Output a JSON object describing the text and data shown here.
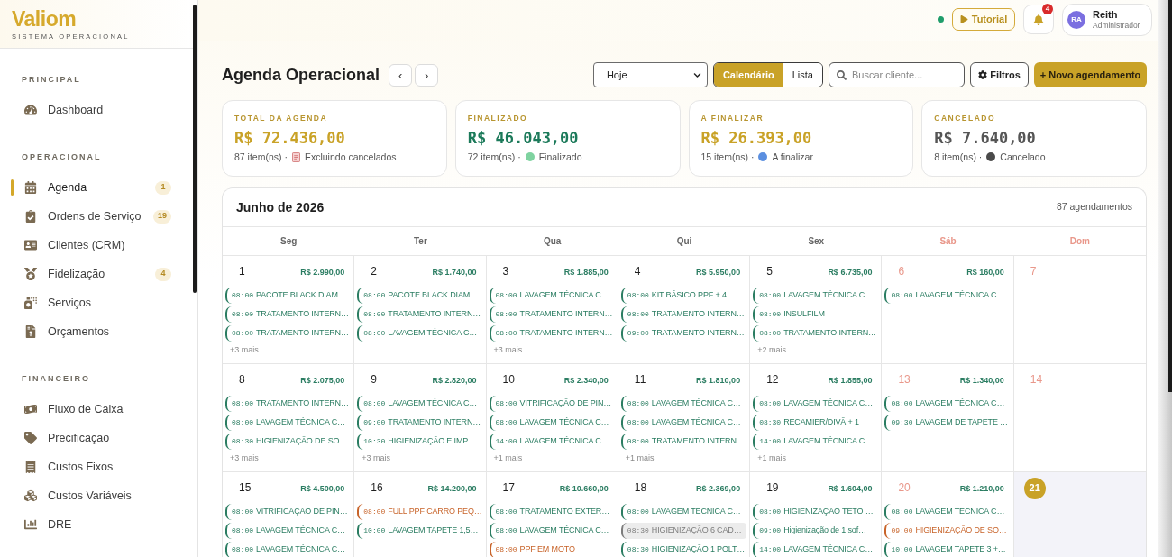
{
  "sidebar": {
    "logo": {
      "name": "Valiom",
      "tagline": "SISTEMA OPERACIONAL"
    },
    "sections": [
      {
        "title": "PRINCIPAL",
        "items": [
          {
            "label": "Dashboard",
            "selected": false
          }
        ]
      },
      {
        "title": "OPERACIONAL",
        "items": [
          {
            "label": "Agenda",
            "badge": "1",
            "selected": true
          },
          {
            "label": "Ordens de Serviço",
            "badge": "19",
            "selected": false
          },
          {
            "label": "Clientes (CRM)",
            "selected": false
          },
          {
            "label": "Fidelização",
            "badge": "4",
            "selected": false
          },
          {
            "label": "Serviços",
            "selected": false
          },
          {
            "label": "Orçamentos",
            "selected": false
          }
        ]
      },
      {
        "title": "FINANCEIRO",
        "items": [
          {
            "label": "Fluxo de Caixa",
            "selected": false
          },
          {
            "label": "Precificação",
            "selected": false
          },
          {
            "label": "Custos Fixos",
            "selected": false
          },
          {
            "label": "Custos Variáveis",
            "selected": false
          },
          {
            "label": "DRE",
            "selected": false
          }
        ]
      }
    ]
  },
  "header": {
    "online": true,
    "tutorial": "Tutorial",
    "notifications": "4",
    "user": {
      "initials": "RA",
      "name": "Reith",
      "role": "Administrador"
    }
  },
  "toolbar": {
    "title": "Agenda Operacional",
    "prev": "‹",
    "next": "›",
    "period": "Hoje",
    "views": [
      {
        "label": "Calendário",
        "selected": true
      },
      {
        "label": "Lista",
        "selected": false
      }
    ],
    "search": {
      "placeholder": "Buscar cliente..."
    },
    "filters": "Filtros",
    "new_button": "+ Novo agendamento"
  },
  "summary_cards": [
    {
      "label": "TOTAL DA AGENDA",
      "amount": "R$ 72.436,00",
      "color": "#c9a227",
      "count": "87 item(ns) ·",
      "icon": {
        "kind": "receipt"
      },
      "note": "Excluindo cancelados"
    },
    {
      "label": "FINALIZADO",
      "amount": "R$ 46.043,00",
      "color": "#1c7a5a",
      "count": "72 item(ns) ·",
      "icon": {
        "kind": "dot",
        "color": "#7fd3a0"
      },
      "note": "Finalizado"
    },
    {
      "label": "A FINALIZAR",
      "amount": "R$ 26.393,00",
      "color": "#c9a227",
      "count": "15 item(ns) ·",
      "icon": {
        "kind": "dot",
        "color": "#5b8fe0"
      },
      "note": "A finalizar"
    },
    {
      "label": "CANCELADO",
      "amount": "R$ 7.640,00",
      "color": "#555555",
      "count": "8 item(ns) ·",
      "icon": {
        "kind": "dot",
        "color": "#4a4a4a"
      },
      "note": "Cancelado"
    }
  ],
  "calendar": {
    "month": "Junho de 2026",
    "count": "87 agendamentos",
    "weekdays": [
      {
        "label": "Seg",
        "weekend": false
      },
      {
        "label": "Ter",
        "weekend": false
      },
      {
        "label": "Qua",
        "weekend": false
      },
      {
        "label": "Qui",
        "weekend": false
      },
      {
        "label": "Sex",
        "weekend": false
      },
      {
        "label": "Sáb",
        "weekend": true
      },
      {
        "label": "Dom",
        "weekend": true
      }
    ],
    "weeks": [
      {
        "days": [
          {
            "day": "1",
            "total": "R$ 2.990,00",
            "today": false,
            "events": [
              {
                "time": "08:00",
                "title": "PACOTE BLACK DIAM…",
                "color": "#2b7d62",
                "highlighted": false
              },
              {
                "time": "08:00",
                "title": "TRATAMENTO INTERN…",
                "color": "#2b7d62",
                "highlighted": false
              },
              {
                "time": "08:00",
                "title": "TRATAMENTO INTERN…",
                "color": "#2b7d62",
                "highlighted": false
              }
            ],
            "more": "+3 mais"
          },
          {
            "day": "2",
            "total": "R$ 1.740,00",
            "today": false,
            "events": [
              {
                "time": "08:00",
                "title": "PACOTE BLACK DIAM…",
                "color": "#2b7d62",
                "highlighted": false
              },
              {
                "time": "08:00",
                "title": "TRATAMENTO INTERN…",
                "color": "#2b7d62",
                "highlighted": false
              },
              {
                "time": "08:00",
                "title": "LAVAGEM TÉCNICA C…",
                "color": "#2b7d62",
                "highlighted": false
              }
            ]
          },
          {
            "day": "3",
            "total": "R$ 1.885,00",
            "today": false,
            "events": [
              {
                "time": "08:00",
                "title": "LAVAGEM TÉCNICA C…",
                "color": "#2b7d62",
                "highlighted": false
              },
              {
                "time": "08:00",
                "title": "TRATAMENTO INTERN…",
                "color": "#2b7d62",
                "highlighted": false
              },
              {
                "time": "08:00",
                "title": "TRATAMENTO INTERN…",
                "color": "#2b7d62",
                "highlighted": false
              }
            ],
            "more": "+3 mais"
          },
          {
            "day": "4",
            "total": "R$ 5.950,00",
            "today": false,
            "events": [
              {
                "time": "08:00",
                "title": "KIT BÁSICO PPF + 4",
                "color": "#2b7d62",
                "highlighted": false
              },
              {
                "time": "08:00",
                "title": "TRATAMENTO INTERN…",
                "color": "#2b7d62",
                "highlighted": false
              },
              {
                "time": "09:00",
                "title": "TRATAMENTO INTERN…",
                "color": "#2b7d62",
                "highlighted": false
              }
            ]
          },
          {
            "day": "5",
            "total": "R$ 6.735,00",
            "today": false,
            "events": [
              {
                "time": "08:00",
                "title": "LAVAGEM TÉCNICA C…",
                "color": "#2b7d62",
                "highlighted": false
              },
              {
                "time": "08:00",
                "title": "INSULFILM",
                "color": "#2b7d62",
                "highlighted": false
              },
              {
                "time": "08:00",
                "title": "TRATAMENTO INTERN…",
                "color": "#2b7d62",
                "highlighted": false
              }
            ],
            "more": "+2 mais"
          },
          {
            "day": "6",
            "total": "R$ 160,00",
            "today": false,
            "events": [
              {
                "time": "08:00",
                "title": "LAVAGEM TÉCNICA C…",
                "color": "#2b7d62",
                "highlighted": false
              }
            ]
          },
          {
            "day": "7",
            "today": false
          }
        ]
      },
      {
        "days": [
          {
            "day": "8",
            "total": "R$ 2.075,00",
            "today": false,
            "events": [
              {
                "time": "08:00",
                "title": "TRATAMENTO INTERN…",
                "color": "#2b7d62",
                "highlighted": false
              },
              {
                "time": "08:00",
                "title": "LAVAGEM TÉCNICA C…",
                "color": "#2b7d62",
                "highlighted": false
              },
              {
                "time": "08:30",
                "title": "HIGIENIZAÇÃO DE SO…",
                "color": "#2b7d62",
                "highlighted": false
              }
            ],
            "more": "+3 mais"
          },
          {
            "day": "9",
            "total": "R$ 2.820,00",
            "today": false,
            "events": [
              {
                "time": "08:00",
                "title": "LAVAGEM TÉCNICA C…",
                "color": "#2b7d62",
                "highlighted": false
              },
              {
                "time": "09:00",
                "title": "TRATAMENTO INTERN…",
                "color": "#2b7d62",
                "highlighted": false
              },
              {
                "time": "10:30",
                "title": "HIGIENIZAÇÃO E IMP…",
                "color": "#2b7d62",
                "highlighted": false
              }
            ],
            "more": "+3 mais"
          },
          {
            "day": "10",
            "total": "R$ 2.340,00",
            "today": false,
            "events": [
              {
                "time": "08:00",
                "title": "VITRIFICAÇÃO DE PIN…",
                "color": "#2b7d62",
                "highlighted": false
              },
              {
                "time": "08:00",
                "title": "LAVAGEM TÉCNICA C…",
                "color": "#2b7d62",
                "highlighted": false
              },
              {
                "time": "14:00",
                "title": "LAVAGEM TÉCNICA C…",
                "color": "#2b7d62",
                "highlighted": false
              }
            ],
            "more": "+1 mais"
          },
          {
            "day": "11",
            "total": "R$ 1.810,00",
            "today": false,
            "events": [
              {
                "time": "08:00",
                "title": "LAVAGEM TÉCNICA C…",
                "color": "#2b7d62",
                "highlighted": false
              },
              {
                "time": "08:00",
                "title": "LAVAGEM TÉCNICA C…",
                "color": "#2b7d62",
                "highlighted": false
              },
              {
                "time": "08:00",
                "title": "TRATAMENTO INTERN…",
                "color": "#2b7d62",
                "highlighted": false
              }
            ],
            "more": "+1 mais"
          },
          {
            "day": "12",
            "total": "R$ 1.855,00",
            "today": false,
            "events": [
              {
                "time": "08:00",
                "title": "LAVAGEM TÉCNICA C…",
                "color": "#2b7d62",
                "highlighted": false
              },
              {
                "time": "08:30",
                "title": "RECAMIER/DIVÃ + 1",
                "color": "#2b7d62",
                "highlighted": false
              },
              {
                "time": "14:00",
                "title": "LAVAGEM TÉCNICA C…",
                "color": "#2b7d62",
                "highlighted": false
              }
            ],
            "more": "+1 mais"
          },
          {
            "day": "13",
            "total": "R$ 1.340,00",
            "today": false,
            "events": [
              {
                "time": "08:00",
                "title": "LAVAGEM TÉCNICA C…",
                "color": "#2b7d62",
                "highlighted": false
              },
              {
                "time": "09:30",
                "title": "LAVAGEM DE TAPETE …",
                "color": "#2b7d62",
                "highlighted": false
              }
            ]
          },
          {
            "day": "14",
            "today": false
          }
        ]
      },
      {
        "days": [
          {
            "day": "15",
            "total": "R$ 4.500,00",
            "today": false,
            "events": [
              {
                "time": "08:00",
                "title": "VITRIFICAÇÃO DE PIN…",
                "color": "#2b7d62",
                "highlighted": false
              },
              {
                "time": "08:00",
                "title": "LAVAGEM TÉCNICA C…",
                "color": "#2b7d62",
                "highlighted": false
              },
              {
                "time": "08:00",
                "title": "LAVAGEM TÉCNICA C…",
                "color": "#2b7d62",
                "highlighted": false
              }
            ]
          },
          {
            "day": "16",
            "total": "R$ 14.200,00",
            "today": false,
            "events": [
              {
                "time": "08:00",
                "title": "FULL PPF CARRO PEQ…",
                "color": "#c8642a",
                "highlighted": false
              },
              {
                "time": "10:00",
                "title": "LAVAGEM TAPETE 1,5…",
                "color": "#2b7d62",
                "highlighted": false
              }
            ]
          },
          {
            "day": "17",
            "total": "R$ 10.660,00",
            "today": false,
            "events": [
              {
                "time": "08:00",
                "title": "TRATAMENTO EXTER…",
                "color": "#2b7d62",
                "highlighted": false
              },
              {
                "time": "08:00",
                "title": "LAVAGEM TÉCNICA C…",
                "color": "#2b7d62",
                "highlighted": false
              },
              {
                "time": "08:00",
                "title": "PPF EM MOTO",
                "color": "#c8642a",
                "highlighted": false
              }
            ]
          },
          {
            "day": "18",
            "total": "R$ 2.369,00",
            "today": false,
            "events": [
              {
                "time": "08:00",
                "title": "LAVAGEM TÉCNICA C…",
                "color": "#2b7d62",
                "highlighted": false
              },
              {
                "time": "08:30",
                "title": "HIGIENIZAÇÃO 6 CAD…",
                "color": "#7d7d7d",
                "highlighted": true
              },
              {
                "time": "08:30",
                "title": "HIGIENIZAÇÃO 1 POLT…",
                "color": "#2b7d62",
                "highlighted": false
              }
            ]
          },
          {
            "day": "19",
            "total": "R$ 1.604,00",
            "today": false,
            "events": [
              {
                "time": "08:00",
                "title": "HIGIENIZAÇÃO TETO …",
                "color": "#2b7d62",
                "highlighted": false
              },
              {
                "time": "09:00",
                "title": "Higienização de 1 sof…",
                "color": "#2b7d62",
                "highlighted": false
              },
              {
                "time": "14:00",
                "title": "LAVAGEM TÉCNICA C…",
                "color": "#2b7d62",
                "highlighted": false
              }
            ]
          },
          {
            "day": "20",
            "total": "R$ 1.210,00",
            "today": false,
            "events": [
              {
                "time": "08:00",
                "title": "LAVAGEM TÉCNICA C…",
                "color": "#2b7d62",
                "highlighted": false
              },
              {
                "time": "09:00",
                "title": "HIGIENIZAÇÃO DE SO…",
                "color": "#c8642a",
                "highlighted": false
              },
              {
                "time": "10:00",
                "title": "LAVAGEM TAPETE 3 +…",
                "color": "#2b7d62",
                "highlighted": false
              }
            ]
          },
          {
            "day": "21",
            "today": true
          }
        ]
      }
    ]
  }
}
